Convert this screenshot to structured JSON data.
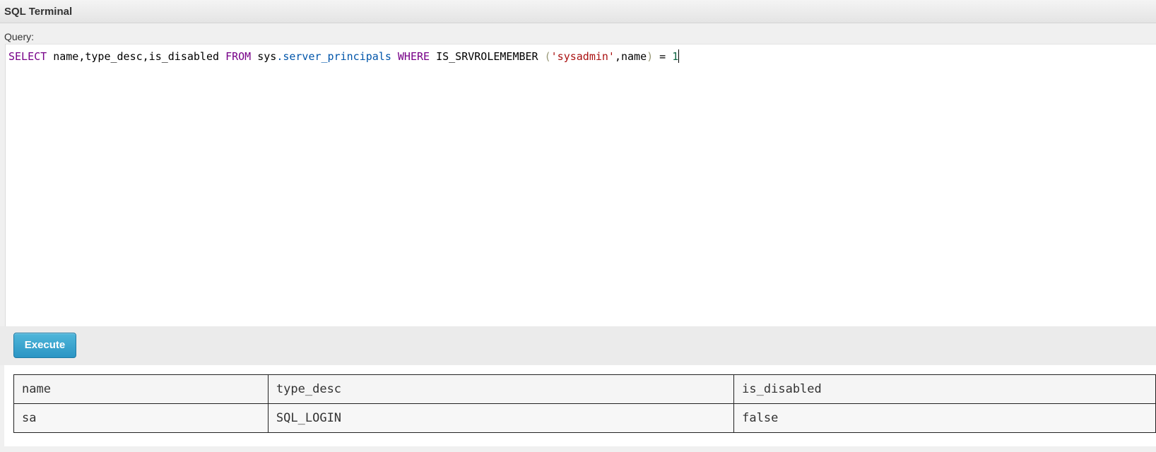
{
  "window": {
    "title": "SQL Terminal"
  },
  "query": {
    "label": "Query:",
    "tokens": {
      "t1": "SELECT",
      "t2": " name,type_desc,is_disabled ",
      "t3": "FROM",
      "t4": " sys",
      "t5": ".server_principals",
      "t6": " ",
      "t7": "WHERE",
      "t8": " IS_SRVROLEMEMBER ",
      "t9": "(",
      "t10": "'sysadmin'",
      "t11": ",name",
      "t12": ")",
      "t13": " = ",
      "t14": "1"
    }
  },
  "toolbar": {
    "execute_label": "Execute"
  },
  "results": {
    "headers": [
      "name",
      "type_desc",
      "is_disabled"
    ],
    "rows": [
      [
        "sa",
        "SQL_LOGIN",
        "false"
      ]
    ]
  },
  "colors": {
    "keyword": "#770088",
    "property": "#0055aa",
    "string": "#aa1111",
    "number": "#116644",
    "button": "#2b95c4"
  }
}
